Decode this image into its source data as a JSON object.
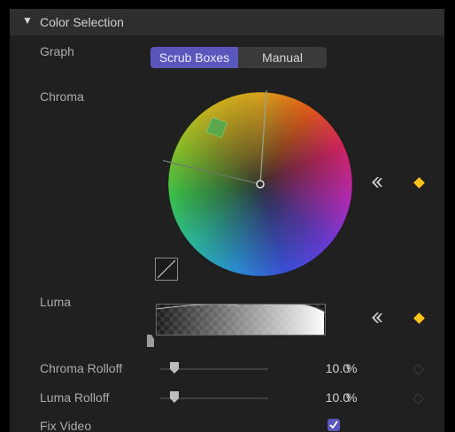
{
  "section": {
    "collapse_glyph": "▼",
    "title": "Color Selection"
  },
  "graph": {
    "label": "Graph",
    "modes": [
      "Scrub Boxes",
      "Manual"
    ],
    "selected": "Scrub Boxes"
  },
  "chroma": {
    "label": "Chroma",
    "icons": {
      "curve": "curve-icon",
      "keyframe_nav": "keyframe-previous-icon",
      "keyframe": "keyframe-diamond-icon"
    }
  },
  "luma": {
    "label": "Luma"
  },
  "chroma_rolloff": {
    "label": "Chroma Rolloff",
    "value": "10.0",
    "unit": "%"
  },
  "luma_rolloff": {
    "label": "Luma Rolloff",
    "value": "10.0",
    "unit": "%"
  },
  "fix_video": {
    "label": "Fix Video",
    "checked": true
  },
  "colors": {
    "accent": "#5b56bc",
    "keyframe": "#ffc21a",
    "panel": "#202020",
    "header": "#2e2e2e"
  }
}
